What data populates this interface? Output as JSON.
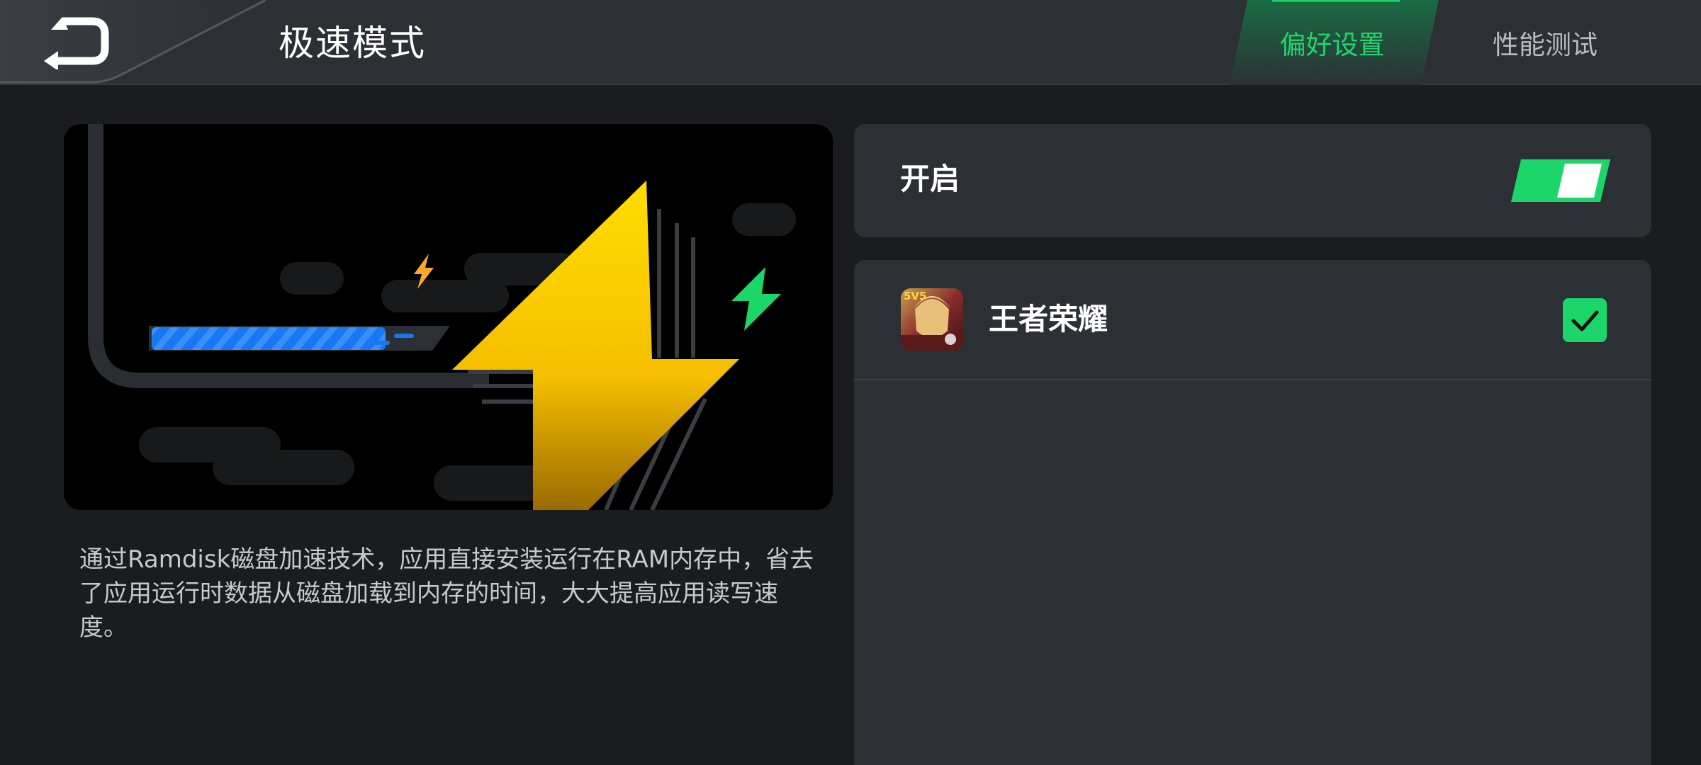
{
  "header": {
    "back_icon": "back-arrow-icon",
    "title": "极速模式",
    "tabs": [
      {
        "label": "偏好设置",
        "active": true
      },
      {
        "label": "性能测试",
        "active": false
      }
    ]
  },
  "hero": {
    "illustration": "lightning-speed-illustration"
  },
  "description": "通过Ramdisk磁盘加速技术，应用直接安装运行在RAM内存中，省去了应用运行时数据从磁盘加载到内存的时间，大大提高应用读写速度。",
  "toggle": {
    "label": "开启",
    "on": true
  },
  "apps": [
    {
      "name": "王者荣耀",
      "checked": true,
      "icon": "game-hero-icon",
      "badge": "5V5"
    }
  ],
  "colors": {
    "accent": "#1dd66a",
    "background": "#1b1c1f",
    "card": "#2c3035",
    "topbar": "#2c3035",
    "bolt_yellow": "#ffd400"
  }
}
